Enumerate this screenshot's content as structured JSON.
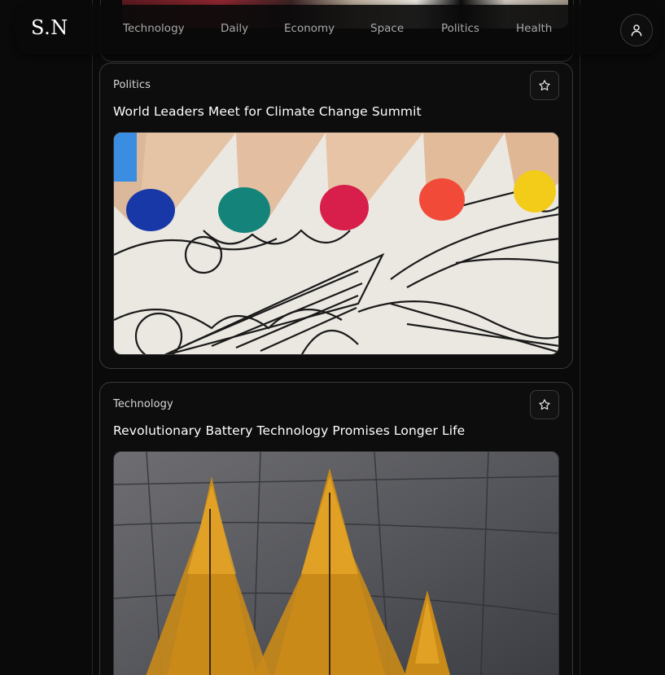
{
  "brand": {
    "logo": "S.N"
  },
  "nav": {
    "items": [
      {
        "label": "Technology"
      },
      {
        "label": "Daily"
      },
      {
        "label": "Economy"
      },
      {
        "label": "Space"
      },
      {
        "label": "Politics"
      },
      {
        "label": "Health"
      }
    ],
    "user_icon": "user-icon"
  },
  "articles": [
    {
      "category": "Politics",
      "title": "World Leaders Meet for Climate Change Summit",
      "image": "colored-pencils-coloring-page",
      "bookmark_icon": "star-icon"
    },
    {
      "category": "Technology",
      "title": "Revolutionary Battery Technology Promises Longer Life",
      "image": "golden-larch-trees-rock-wall",
      "bookmark_icon": "star-icon"
    }
  ],
  "colors": {
    "background": "#0a0a0a",
    "card_border": "#3a3a3a",
    "nav_text": "#a8a8a8"
  }
}
